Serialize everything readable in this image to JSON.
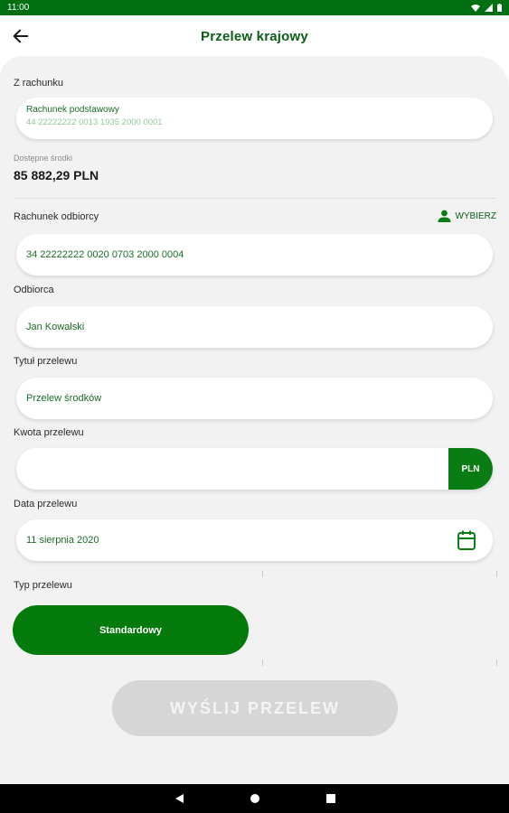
{
  "status": {
    "time": "11:00"
  },
  "header": {
    "title": "Przelew krajowy"
  },
  "from": {
    "label": "Z rachunku",
    "account_name": "Rachunek podstawowy",
    "account_number": "44 22222222 0013 1935 2000 0001",
    "available_label": "Dostępne środki",
    "available_amount": "85 882,29 PLN"
  },
  "recipient_account": {
    "label": "Rachunek odbiorcy",
    "choose_label": "WYBIERZ",
    "value": "34 22222222 0020 0703 2000 0004"
  },
  "recipient": {
    "label": "Odbiorca",
    "value": "Jan Kowalski"
  },
  "title_field": {
    "label": "Tytuł przelewu",
    "value": "Przelew środków"
  },
  "amount": {
    "label": "Kwota przelewu",
    "value": "",
    "currency": "PLN"
  },
  "date": {
    "label": "Data przelewu",
    "value": "11 sierpnia 2020"
  },
  "transfer_type": {
    "label": "Typ przelewu",
    "selected": "Standardowy"
  },
  "submit": {
    "label": "WYŚLIJ PRZELEW"
  },
  "colors": {
    "primary": "#057a0c",
    "status_bar": "#006f12",
    "panel": "#f2f2f2",
    "disabled": "#d6d6d6"
  },
  "icons": [
    "back-arrow-icon",
    "person-icon",
    "calendar-icon",
    "wifi-icon",
    "signal-icon",
    "battery-icon",
    "nav-back-icon",
    "nav-home-icon",
    "nav-recents-icon"
  ]
}
